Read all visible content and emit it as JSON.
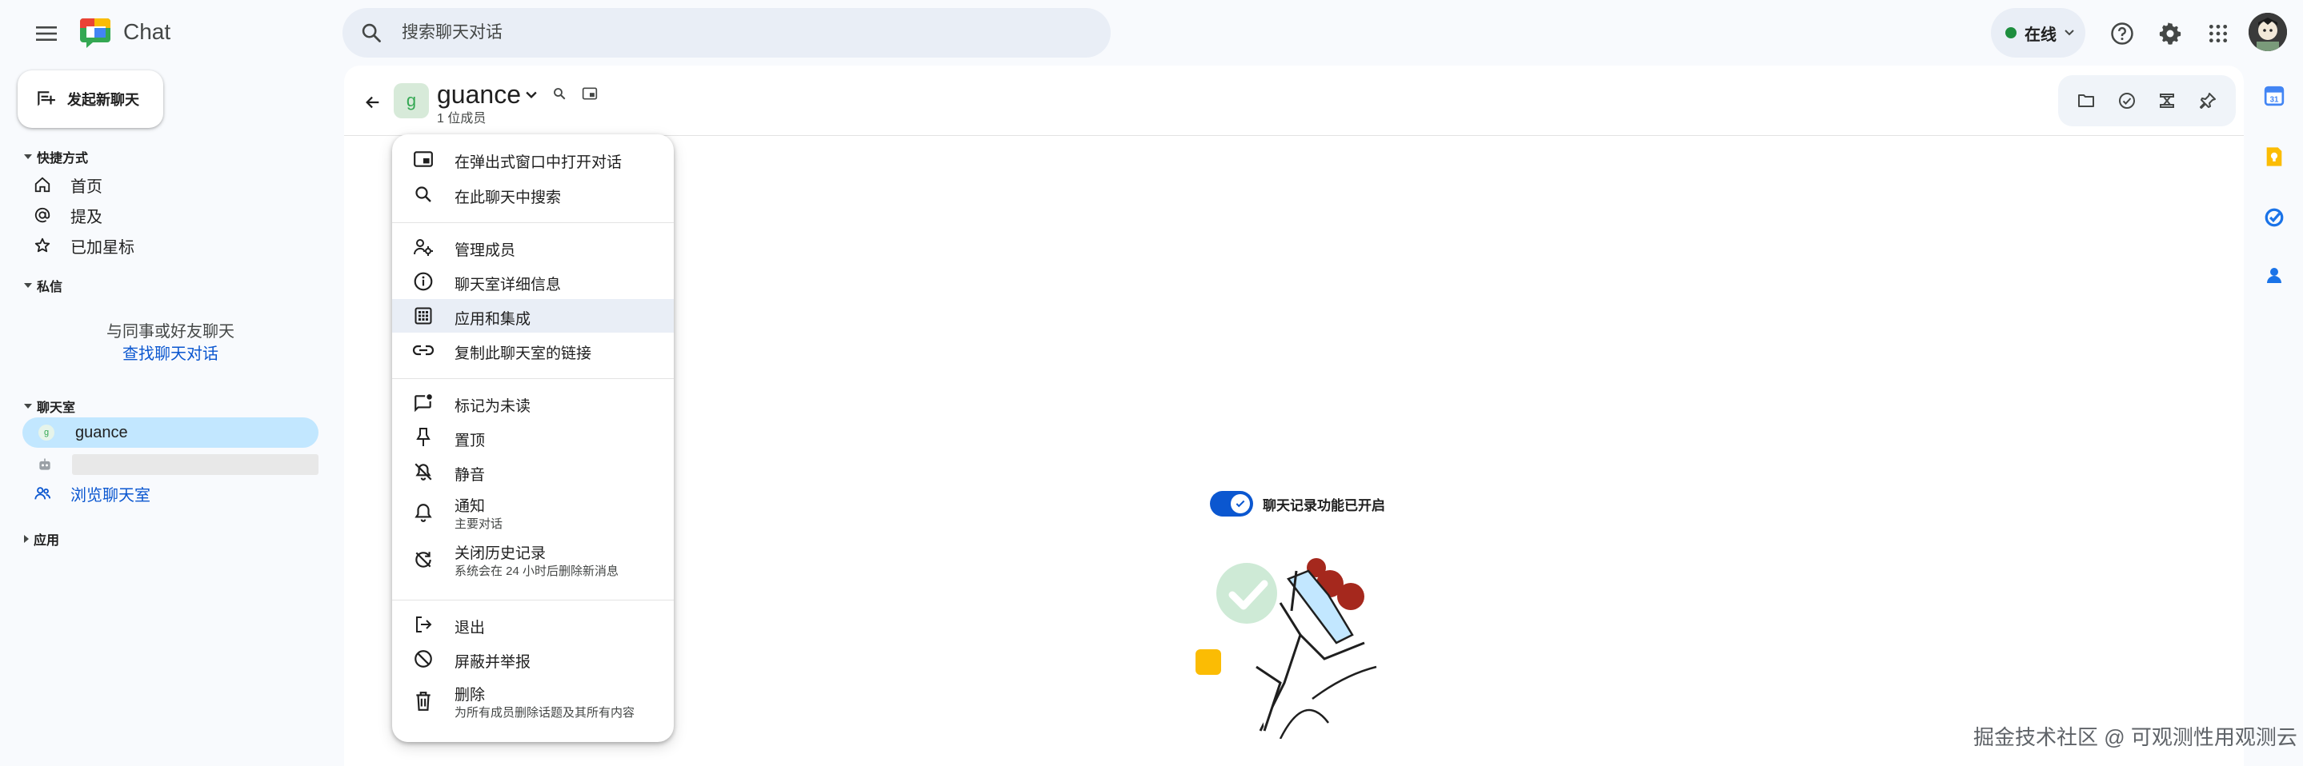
{
  "app": {
    "name": "Chat"
  },
  "search": {
    "placeholder": "搜索聊天对话"
  },
  "status": {
    "label": "在线"
  },
  "new_chat": {
    "label": "发起新聊天"
  },
  "sidebar": {
    "shortcuts": {
      "title": "快捷方式",
      "items": [
        {
          "label": "首页"
        },
        {
          "label": "提及"
        },
        {
          "label": "已加星标"
        }
      ]
    },
    "dm": {
      "title": "私信",
      "hint": "与同事或好友聊天",
      "link": "查找聊天对话"
    },
    "rooms": {
      "title": "聊天室",
      "items": [
        {
          "label": "guance",
          "avatar": "g"
        }
      ],
      "browse": "浏览聊天室"
    },
    "apps": {
      "title": "应用"
    }
  },
  "room": {
    "name": "guance",
    "avatar": "g",
    "members": "1 位成员"
  },
  "history": {
    "label": "聊天记录功能已开启"
  },
  "menu": {
    "items": [
      {
        "label": "在弹出式窗口中打开对话",
        "icon": "popout-icon"
      },
      {
        "label": "在此聊天中搜索",
        "icon": "search-icon"
      },
      {
        "label": "管理成员",
        "icon": "manage-members-icon"
      },
      {
        "label": "聊天室详细信息",
        "icon": "info-icon"
      },
      {
        "label": "应用和集成",
        "icon": "apps-grid-icon"
      },
      {
        "label": "复制此聊天室的链接",
        "icon": "link-icon"
      },
      {
        "label": "标记为未读",
        "icon": "mark-unread-icon"
      },
      {
        "label": "置顶",
        "icon": "pin-icon"
      },
      {
        "label": "静音",
        "icon": "mute-icon"
      },
      {
        "label": "通知",
        "sub": "主要对话",
        "icon": "bell-icon"
      },
      {
        "label": "关闭历史记录",
        "sub": "系统会在 24 小时后删除新消息",
        "icon": "history-off-icon"
      },
      {
        "label": "退出",
        "icon": "exit-icon"
      },
      {
        "label": "屏蔽并举报",
        "icon": "block-icon"
      },
      {
        "label": "删除",
        "sub": "为所有成员删除话题及其所有内容",
        "icon": "trash-icon"
      }
    ]
  },
  "watermark": "掘金技术社区 @ 可观测性用观测云",
  "colors": {
    "accent": "#0b57d0",
    "selected": "#c2e7ff",
    "online": "#1e8e3e"
  }
}
